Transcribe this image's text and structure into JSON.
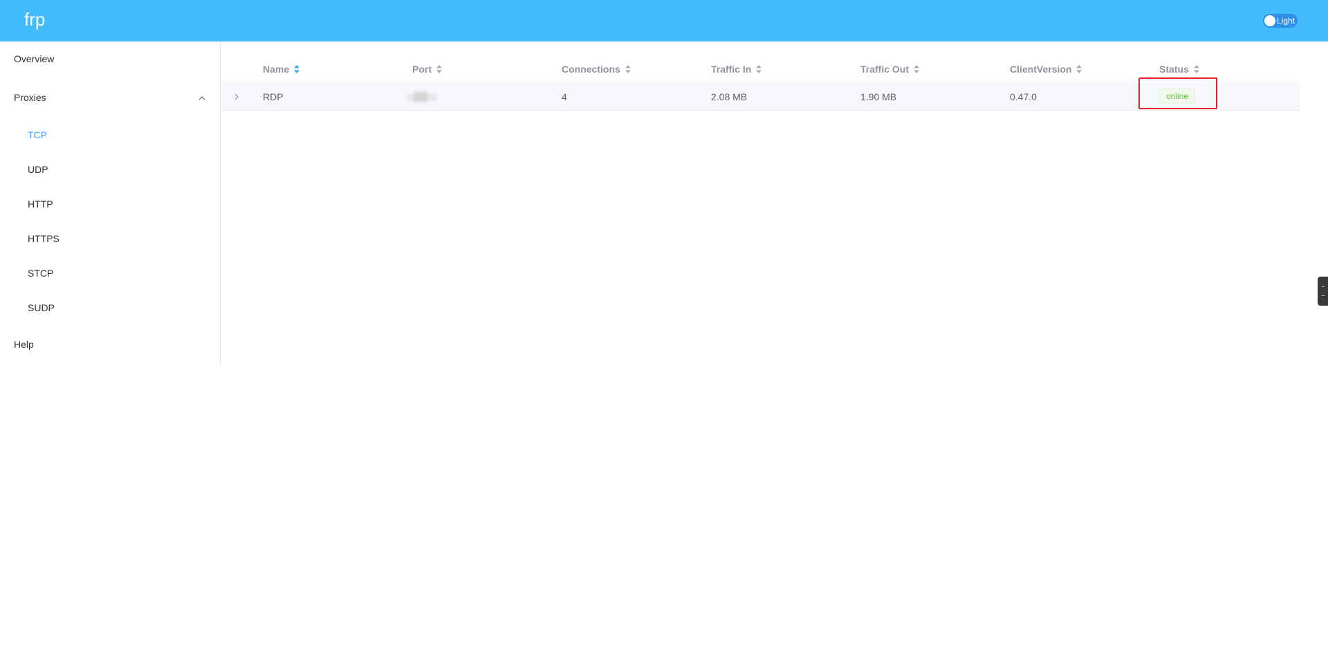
{
  "header": {
    "brand": "frp",
    "theme_toggle_label": "Light",
    "background_color": "#44bbfb"
  },
  "sidebar": {
    "overview": "Overview",
    "proxies": "Proxies",
    "proxies_icon": "chevron-up-icon",
    "sub_items": [
      {
        "label": "TCP",
        "active": true
      },
      {
        "label": "UDP",
        "active": false
      },
      {
        "label": "HTTP",
        "active": false
      },
      {
        "label": "HTTPS",
        "active": false
      },
      {
        "label": "STCP",
        "active": false
      },
      {
        "label": "SUDP",
        "active": false
      }
    ],
    "help": "Help",
    "active_color": "#409eff"
  },
  "table": {
    "columns": [
      "Name",
      "Port",
      "Connections",
      "Traffic In",
      "Traffic Out",
      "ClientVersion",
      "Status"
    ],
    "sort_icon": "sort-caret-icon",
    "rows": [
      {
        "name": "RDP",
        "port": "",
        "connections": "4",
        "traffic_in": "2.08 MB",
        "traffic_out": "1.90 MB",
        "client_version": "0.47.0",
        "status": "online"
      }
    ],
    "status_color": "#67c23a",
    "highlight_color": "#e81e25"
  }
}
